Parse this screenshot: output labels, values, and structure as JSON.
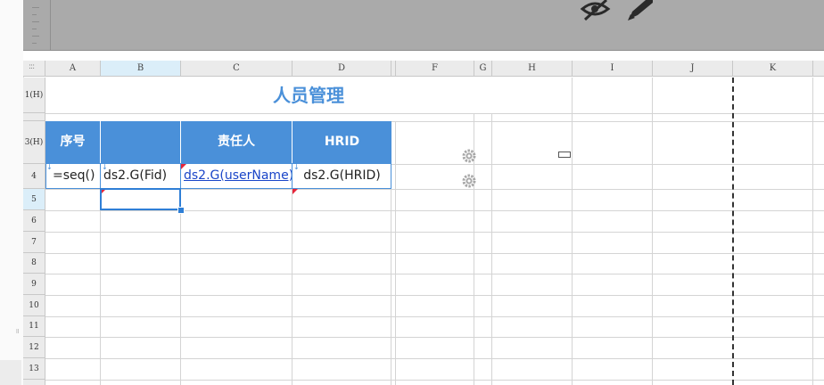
{
  "sheet": {
    "title": "人员管理",
    "columns": [
      "A",
      "B",
      "C",
      "D",
      "F",
      "G",
      "H",
      "I",
      "J",
      "K"
    ],
    "selected_column": "B",
    "rows": [
      "1(H)",
      "3(H)",
      "4",
      "5",
      "6",
      "7",
      "8",
      "9",
      "10",
      "11",
      "12",
      "13"
    ],
    "selected_row": "5",
    "headers": {
      "a": "序号",
      "b": "",
      "c": "责任人",
      "d": "HRID"
    },
    "cells": {
      "a4": "=seq()",
      "b4": "ds2.G(Fid)",
      "c4": "ds2.G(userName)",
      "d4": "ds2.G(HRID)"
    }
  },
  "toolbar": {
    "icons": [
      "eye-slash-icon",
      "pencil-icon"
    ]
  },
  "colors": {
    "accent": "#4a90d9",
    "link": "#1a45c8",
    "flag": "#e6253a",
    "selection": "#2f7fd6"
  }
}
